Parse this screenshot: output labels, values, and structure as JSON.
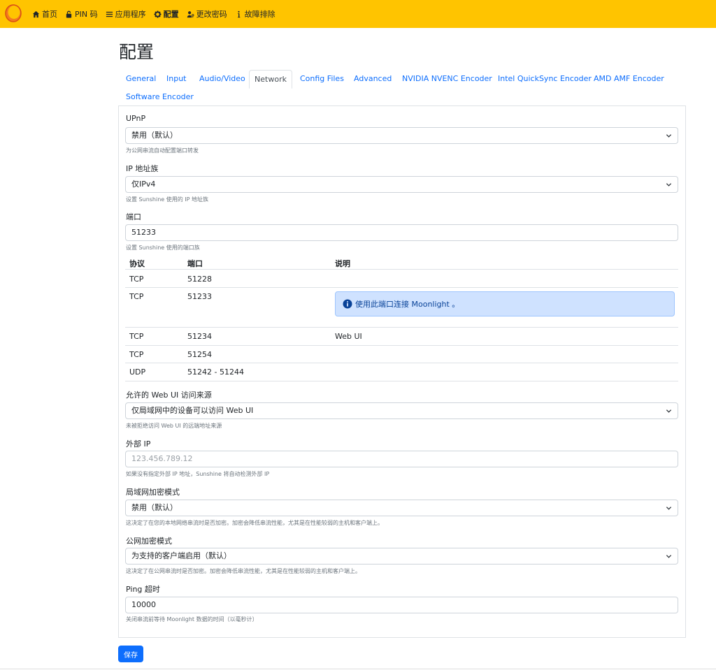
{
  "nav": {
    "items": [
      {
        "label": "首页",
        "icon": "home-icon"
      },
      {
        "label": "PIN 码",
        "icon": "lock-icon"
      },
      {
        "label": "应用程序",
        "icon": "list-icon"
      },
      {
        "label": "配置",
        "icon": "gear-icon"
      },
      {
        "label": "更改密码",
        "icon": "user-key-icon"
      },
      {
        "label": "故障排除",
        "icon": "info-icon"
      }
    ],
    "active_index": 3,
    "accent": "#ffc400"
  },
  "page": {
    "title": "配置"
  },
  "tabs": [
    {
      "label": "General"
    },
    {
      "label": "Input"
    },
    {
      "label": "Audio/Video"
    },
    {
      "label": "Network"
    },
    {
      "label": "Config Files"
    },
    {
      "label": "Advanced"
    },
    {
      "label": "NVIDIA NVENC Encoder"
    },
    {
      "label": "Intel QuickSync Encoder"
    },
    {
      "label": "AMD AMF Encoder"
    },
    {
      "label": "Software Encoder"
    }
  ],
  "active_tab": "Network",
  "fields": {
    "upnp": {
      "label": "UPnP",
      "value": "禁用（默认）",
      "hint": "为公网串流自动配置端口转发"
    },
    "ip_family": {
      "label": "IP 地址族",
      "value": "仅IPv4",
      "hint": "设置 Sunshine 使用的 IP 地址族"
    },
    "port": {
      "label": "端口",
      "value": "51233",
      "hint": "设置 Sunshine 使用的端口族"
    },
    "origin": {
      "label": "允许的 Web UI 访问来源",
      "value": "仅局域网中的设备可以访问 Web UI",
      "hint": "未被拒绝访问 Web UI 的远端地址来源"
    },
    "external_ip": {
      "label": "外部 IP",
      "placeholder": "123.456.789.12",
      "hint": "如果没有指定外部 IP 地址，Sunshine 将自动检测外部 IP"
    },
    "lan_encryption": {
      "label": "局域网加密模式",
      "value": "禁用（默认）",
      "hint": "这决定了在您的本地网络串流时是否加密。加密会降低串流性能，尤其是在性能较弱的主机和客户端上。"
    },
    "wan_encryption": {
      "label": "公网加密模式",
      "value": "为支持的客户端启用（默认）",
      "hint": "这决定了在公网串流时是否加密。加密会降低串流性能，尤其是在性能较弱的主机和客户端上。"
    },
    "ping_timeout": {
      "label": "Ping 超时",
      "value": "10000",
      "hint": "关闭串流前等待 Moonlight 数据的时间（以毫秒计）"
    }
  },
  "port_table": {
    "headers": [
      "协议",
      "端口",
      "说明"
    ],
    "rows": [
      {
        "protocol": "TCP",
        "port": "51228",
        "note": ""
      },
      {
        "protocol": "TCP",
        "port": "51233",
        "note": "使用此端口连接 Moonlight 。"
      },
      {
        "protocol": "TCP",
        "port": "51234",
        "note": "Web UI"
      },
      {
        "protocol": "TCP",
        "port": "51254",
        "note": ""
      },
      {
        "protocol": "UDP",
        "port": "51242 - 51244",
        "note": ""
      }
    ]
  },
  "save_label": "保存"
}
